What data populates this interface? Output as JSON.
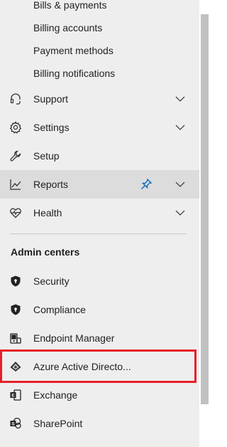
{
  "billing_subitems": [
    "Bills & payments",
    "Billing accounts",
    "Payment methods",
    "Billing notifications"
  ],
  "nav_items": [
    {
      "label": "Support",
      "icon": "headset-icon",
      "expandable": true
    },
    {
      "label": "Settings",
      "icon": "gear-icon",
      "expandable": true
    },
    {
      "label": "Setup",
      "icon": "wrench-icon",
      "expandable": false
    },
    {
      "label": "Reports",
      "icon": "line-chart-icon",
      "expandable": true,
      "selected": true,
      "pinned": true
    },
    {
      "label": "Health",
      "icon": "heart-pulse-icon",
      "expandable": true
    }
  ],
  "admin_centers": {
    "header": "Admin centers",
    "items": [
      {
        "label": "Security",
        "icon": "shield-icon"
      },
      {
        "label": "Compliance",
        "icon": "shield-icon"
      },
      {
        "label": "Endpoint Manager",
        "icon": "devices-icon"
      },
      {
        "label": "Azure Active Directo...",
        "icon": "azure-ad-icon",
        "highlighted": true
      },
      {
        "label": "Exchange",
        "icon": "exchange-icon"
      },
      {
        "label": "SharePoint",
        "icon": "sharepoint-icon"
      }
    ]
  },
  "colors": {
    "nav_background": "#eeeeee",
    "selected_row": "#dcdcdc",
    "pin_accent": "#0f6cbd",
    "highlight_border": "#e5202a"
  }
}
